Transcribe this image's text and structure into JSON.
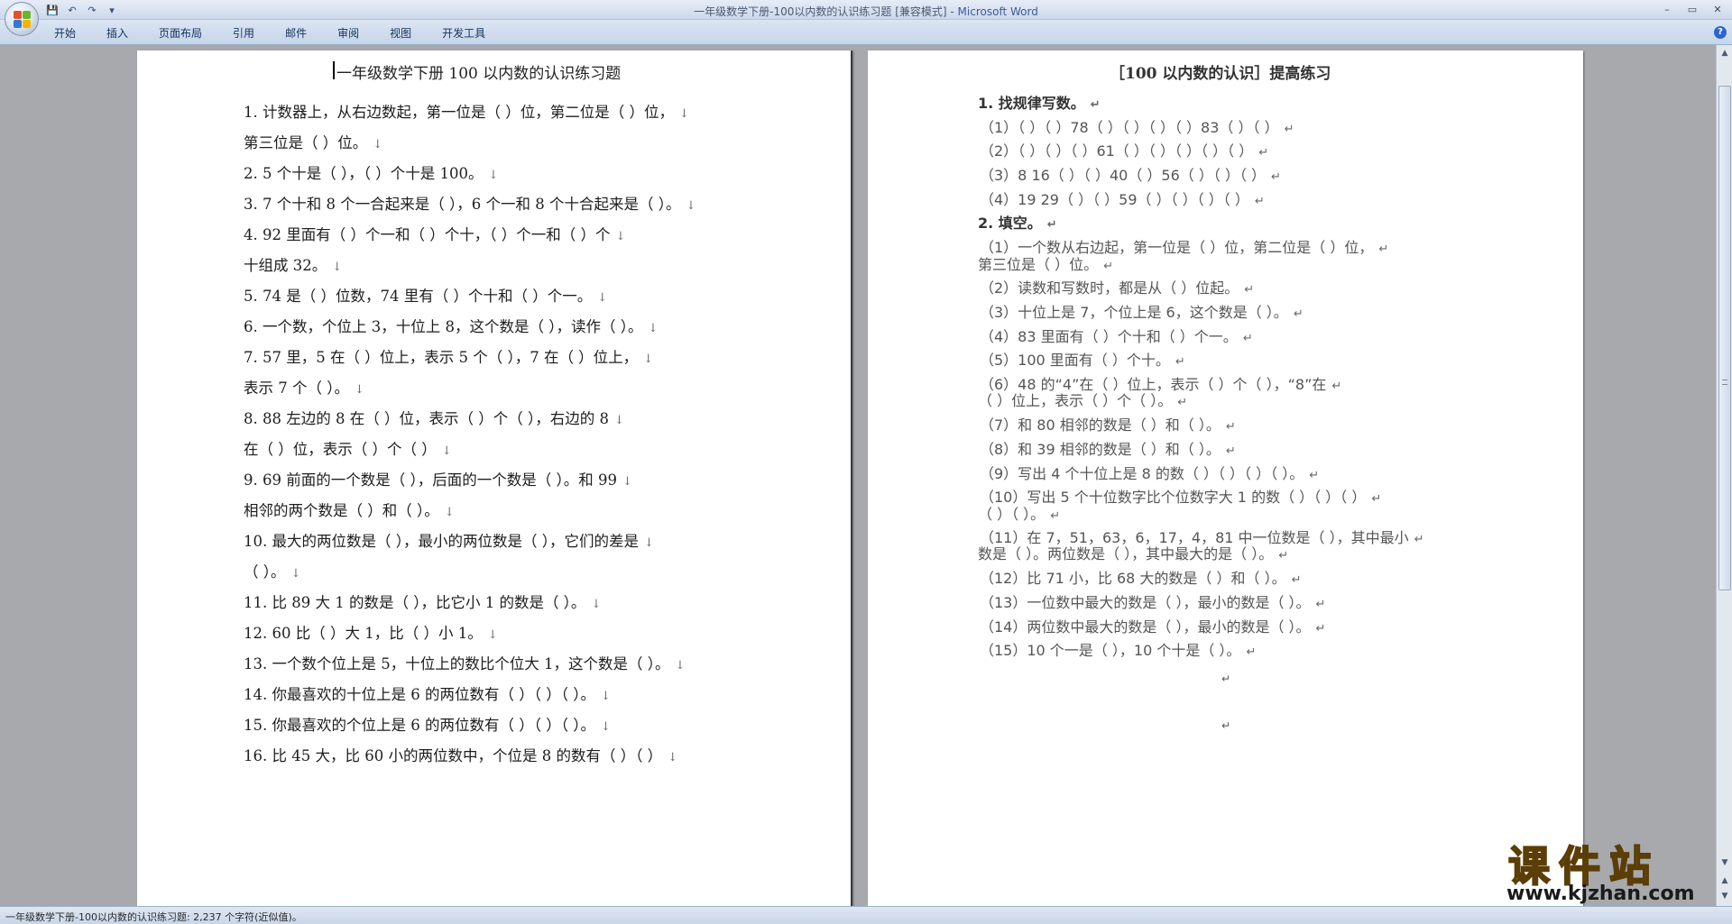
{
  "window": {
    "title_main": "一年级数学下册-100以内数的认识练习题 [兼容模式] - ",
    "title_brand": "Microsoft Word"
  },
  "quick_access": {
    "save_icon": "💾",
    "undo_icon": "↶",
    "redo_icon": "↷",
    "more_icon": "▾"
  },
  "window_controls": {
    "minimize": "–",
    "restore": "▭",
    "close": "✕"
  },
  "ribbon": {
    "tabs": [
      "开始",
      "插入",
      "页面布局",
      "引用",
      "邮件",
      "审阅",
      "视图",
      "开发工具"
    ],
    "help": "?"
  },
  "left_page": {
    "title": "一年级数学下册 100 以内数的认识练习题",
    "lines": [
      "1. 计数器上，从右边数起，第一位是（   ）位，第二位是（   ）位，",
      "第三位是（  ）位。",
      "2. 5 个十是（   ），（   ）个十是 100。",
      "3. 7 个十和 8 个一合起来是（   ），6 个一和 8 个十合起来是（   ）。",
      "4. 92 里面有（   ）个一和（   ）个十，（   ）个一和（   ）个",
      "十组成 32。",
      "5. 74 是（   ）位数，74 里有（   ）个十和（   ）个一。",
      "6. 一个数，个位上 3，十位上 8，这个数是（   ），读作（   ）。",
      "7. 57 里，5 在（   ）位上，表示 5 个（   ），7 在（   ）位上，",
      "表示 7 个（   ）。",
      "8. 88 左边的 8 在（   ）位，表示（   ）个（   ），右边的 8",
      "在（   ）位，表示（   ）个（   ）",
      "9. 69 前面的一个数是（   ），后面的一个数是（   ）。和 99",
      "相邻的两个数是（   ）和（   ）。",
      "10. 最大的两位数是（   ），最小的两位数是（   ），它们的差是",
      "（   ）。",
      "11. 比 89 大 1 的数是（   ），比它小 1 的数是（   ）。",
      "12. 60 比（   ）大 1，比（   ）小 1。",
      "13. 一个数个位上是 5，十位上的数比个位大 1，这个数是（   ）。",
      "14. 你最喜欢的十位上是 6 的两位数有（   ）（   ）（   ）。",
      "15. 你最喜欢的个位上是 6 的两位数有（   ）（   ）（   ）。",
      "16. 比 45 大，比 60 小的两位数中，个位是 8 的数有（   ）（   ）"
    ]
  },
  "right_page": {
    "title": "［100 以内数的认识］提高练习",
    "lines": [
      "1. 找规律写数。",
      "（1）（   ）（   ）78（   ）（   ）（   ）（   ）83（   ）（   ）",
      "（2）（   ）（   ）（   ）61（   ）（   ）（   ）（   ）（   ）",
      "（3）8      16（   ）（   ）40（   ）56（   ）（   ）（   ）",
      "（4）19   29（   ）（   ）59（   ）（   ）（   ）（   ）",
      "2. 填空。",
      "（1）一个数从右边起，第一位是（   ）位，第二位是（   ）位，",
      "第三位是（   ）位。",
      "（2）读数和写数时，都是从（   ）位起。",
      "（3）十位上是 7，个位上是 6，这个数是（   ）。",
      "（4）83 里面有（   ）个十和（   ）个一。",
      "（5）100 里面有（   ）个十。",
      "（6）48 的“4”在（   ）位上，表示（   ）个（   ），“8”在",
      "（   ）位上，表示（   ）个（   ）。",
      "（7）和 80 相邻的数是（   ）和（   ）。",
      "（8）和 39 相邻的数是（   ）和（   ）。",
      "（9）写出 4 个十位上是 8 的数（   ）（   ）（   ）（   ）。",
      "（10）写出 5 个十位数字比个位数字大 1 的数（   ）（   ）（   ）",
      "（   ）（   ）。",
      "（11）在 7，51，63，6，17，4，81 中一位数是（   ），其中最小",
      "数是（   ）。两位数是（   ），其中最大的是（   ）。",
      "（12）比 71 小，比 68 大的数是（   ）和（   ）。",
      "（13）一位数中最大的数是（   ），最小的数是（   ）。",
      "（14）两位数中最大的数是（   ），最小的数是（   ）。",
      "（15）10 个一是（   ），10 个十是（   ）。"
    ]
  },
  "status": {
    "text": "一年级数学下册-100以内数的认识练习题: 2,237 个字符(近似值)。"
  },
  "watermark": {
    "text": "课件站",
    "url": "www.kjzhan.com"
  },
  "colors": {
    "office_red": "#e2512b",
    "office_green": "#6ab42a",
    "office_blue": "#2f7bd1",
    "office_yellow": "#f4b400",
    "watermark_yellow": "#f2e21a"
  }
}
